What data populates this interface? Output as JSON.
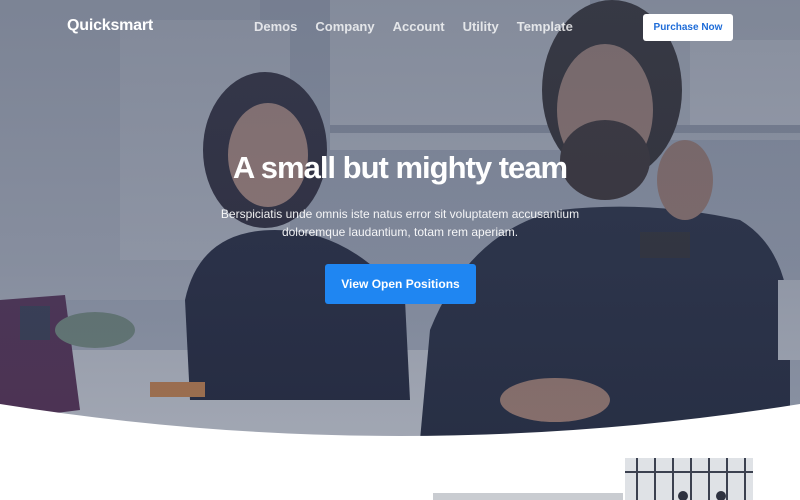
{
  "brand": {
    "name": "Quicksmart"
  },
  "nav": {
    "items": [
      {
        "label": "Demos"
      },
      {
        "label": "Company"
      },
      {
        "label": "Account"
      },
      {
        "label": "Utility"
      },
      {
        "label": "Template"
      }
    ],
    "purchase_label": "Purchase Now"
  },
  "hero": {
    "title": "A small but mighty team",
    "subtitle": "Berspiciatis unde omnis iste natus error sit voluptatem accusantium doloremque laudantium, totam rem aperiam.",
    "cta_label": "View Open Positions"
  },
  "colors": {
    "accent": "#1f86f2",
    "purchase_text": "#1e6cd8",
    "hero_overlay": "#3e4860"
  }
}
